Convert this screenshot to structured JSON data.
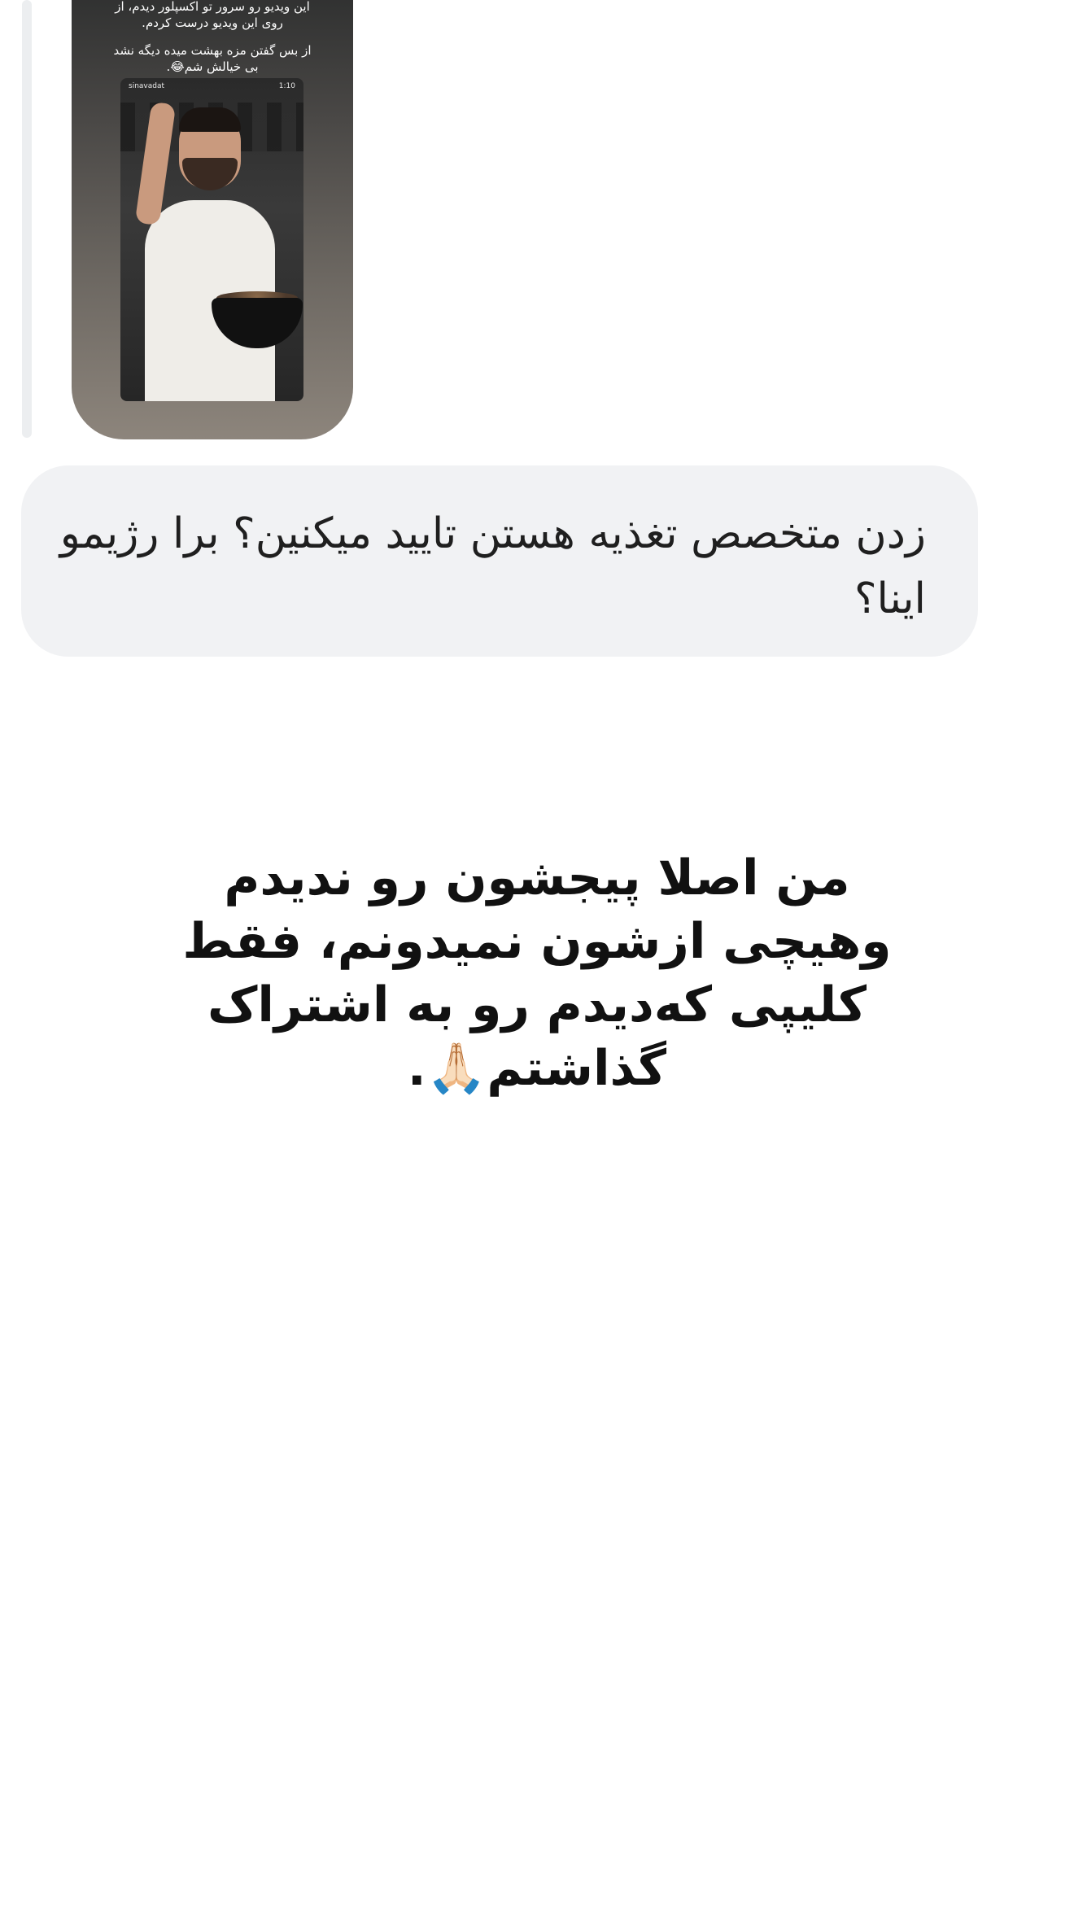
{
  "story": {
    "caption_line1": "این ویدیو رو سرور تو اکسپلور دیدم، از",
    "caption_line2": "روی این ویدیو درست کردم.",
    "caption_line3": "از بس گفتن مزه بهشت میده دیگه نشد",
    "caption_line4": "بی خیالش شم😂.",
    "video_username": "sinavadat",
    "video_time": "1:10"
  },
  "message": {
    "text": "زدن متخصص تغذیه هستن تایید میکنین؟ برا رژیمو اینا؟"
  },
  "overlay_text": {
    "line1": "من اصلا پیجشون رو ندیدم",
    "line2": "وهیچی ازشون نمیدونم، فقط",
    "line3": "کلیپی که‌دیدم رو به اشتراک",
    "line4": "گذاشتم🙏🏻."
  }
}
